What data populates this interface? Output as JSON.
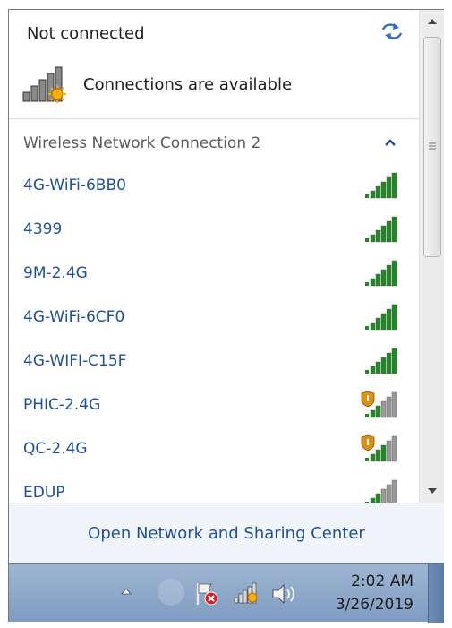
{
  "popup": {
    "status_title": "Not connected",
    "connections_available": "Connections are available",
    "section_title": "Wireless Network Connection 2",
    "footer_link": "Open Network and Sharing Center",
    "refresh_icon": "refresh-icon",
    "colors": {
      "link_blue": "#1f4f9b",
      "signal_green": "#1f8a24",
      "signal_gray": "#9a9a9a",
      "shield_orange": "#e0900f"
    }
  },
  "networks": [
    {
      "name": "4G-WiFi-6BB0",
      "signal_bars": 5,
      "secured": false
    },
    {
      "name": "4399",
      "signal_bars": 5,
      "secured": false
    },
    {
      "name": "9M-2.4G",
      "signal_bars": 5,
      "secured": false
    },
    {
      "name": "4G-WiFi-6CF0",
      "signal_bars": 5,
      "secured": false
    },
    {
      "name": "4G-WIFI-C15F",
      "signal_bars": 5,
      "secured": false
    },
    {
      "name": "PHIC-2.4G",
      "signal_bars": 2,
      "secured": true
    },
    {
      "name": "QC-2.4G",
      "signal_bars": 3,
      "secured": true
    },
    {
      "name": "EDUP",
      "signal_bars": 2,
      "secured": false
    }
  ],
  "taskbar": {
    "time": "2:02 AM",
    "date": "3/26/2019"
  }
}
